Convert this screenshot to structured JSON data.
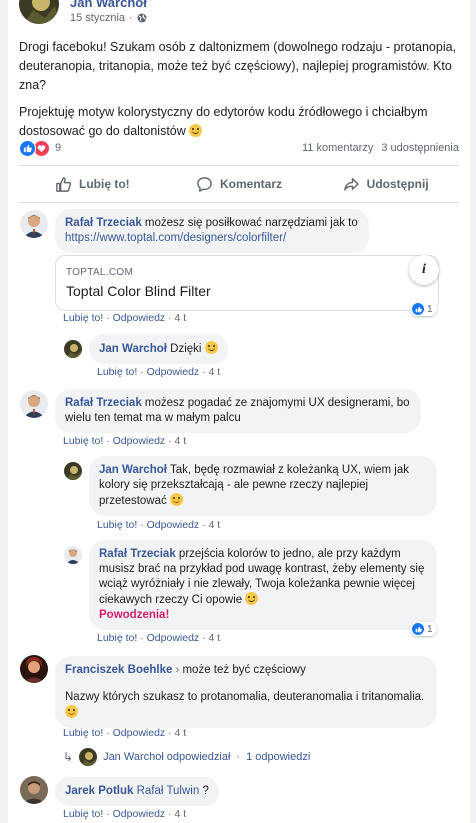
{
  "post": {
    "author": "Jan Warchoł",
    "date": "15 stycznia",
    "date_separator": "·",
    "paragraph1": "Drogi faceboku! Szukam osób z daltonizmem (dowolnego rodzaju - protanopia, deuteranopia, tritanopia, może też być częściowy), najlepiej programistów. Kto zna?",
    "paragraph2": "Projektuję motyw kolorystyczny do edytorów kodu źródłowego i chciałbym dostosować go do daltonistów",
    "reaction_count": "9",
    "comments_count": "11 komentarzy",
    "shares_count": "3 udostępnienia",
    "actions": {
      "like": "Lubię to!",
      "comment": "Komentarz",
      "share": "Udostępnij"
    }
  },
  "comments": [
    {
      "author": "Rafał Trzeciak",
      "text": "możesz się posiłkować narzędziami jak to",
      "link": "https://www.toptal.com/designers/colorfilter/",
      "preview_domain": "TOPTAL.COM",
      "preview_title": "Toptal Color Blind Filter",
      "preview_info": "i",
      "like": "Lubię to!",
      "reply": "Odpowiedz",
      "time": "4 t",
      "reactions": "1"
    },
    {
      "author": "Jan Warchoł",
      "text": "Dzięki",
      "like": "Lubię to!",
      "reply": "Odpowiedz",
      "time": "4 t"
    },
    {
      "author": "Rafał Trzeciak",
      "text": "możesz pogadać ze znajomymi UX designerami, bo wielu ten temat ma w małym palcu",
      "like": "Lubię to!",
      "reply": "Odpowiedz",
      "time": "4 t"
    },
    {
      "author": "Jan Warchoł",
      "text": "Tak, będę rozmawiał z koleżanką UX, wiem jak kolory się przekształcają - ale pewne rzeczy najlepiej przetestować",
      "like": "Lubię to!",
      "reply": "Odpowiedz",
      "time": "4 t"
    },
    {
      "author": "Rafał Trzeciak",
      "text": "przejścia kolorów to jedno, ale przy każdym musisz brać na przykład pod uwagę kontrast, żeby elementy się wciąż wyróżniały i nie zlewały, Twoja koleżanka pewnie więcej ciekawych rzeczy Ci opowie",
      "highlight": "Powodzenia!",
      "like": "Lubię to!",
      "reply": "Odpowiedz",
      "time": "4 t",
      "reactions": "1"
    },
    {
      "author": "Franciszek Boehlke",
      "tag_arrow": "›",
      "tag": "może też być częściowy",
      "text": "Nazwy których szukasz to protanomalia, deuteranomalia i tritanomalia.",
      "like": "Lubię to!",
      "reply": "Odpowiedz",
      "time": "4 t"
    },
    {
      "author": "Jarek Potluk",
      "mention": "Rafał Tulwin",
      "text": "?",
      "like": "Lubię to!",
      "reply": "Odpowiedz",
      "time": "4 t"
    }
  ],
  "replies_summary": {
    "author": "Jan Warchoł",
    "verb": "odpowiedział",
    "separator": "·",
    "count": "1 odpowiedzi"
  },
  "separator": "·",
  "icons": {
    "globe": "globe-icon",
    "like": "thumbs-up-icon",
    "love": "heart-icon",
    "comment": "speech-bubble-icon",
    "share": "share-arrow-icon",
    "reply": "reply-arrow-icon",
    "smile": "smile-emoji",
    "smirk": "smirk-emoji"
  },
  "colors": {
    "link": "#385898",
    "like_blue": "#1877f2",
    "love_red": "#f33e58",
    "bubble": "#f2f3f5",
    "accent": "#d1206b"
  }
}
